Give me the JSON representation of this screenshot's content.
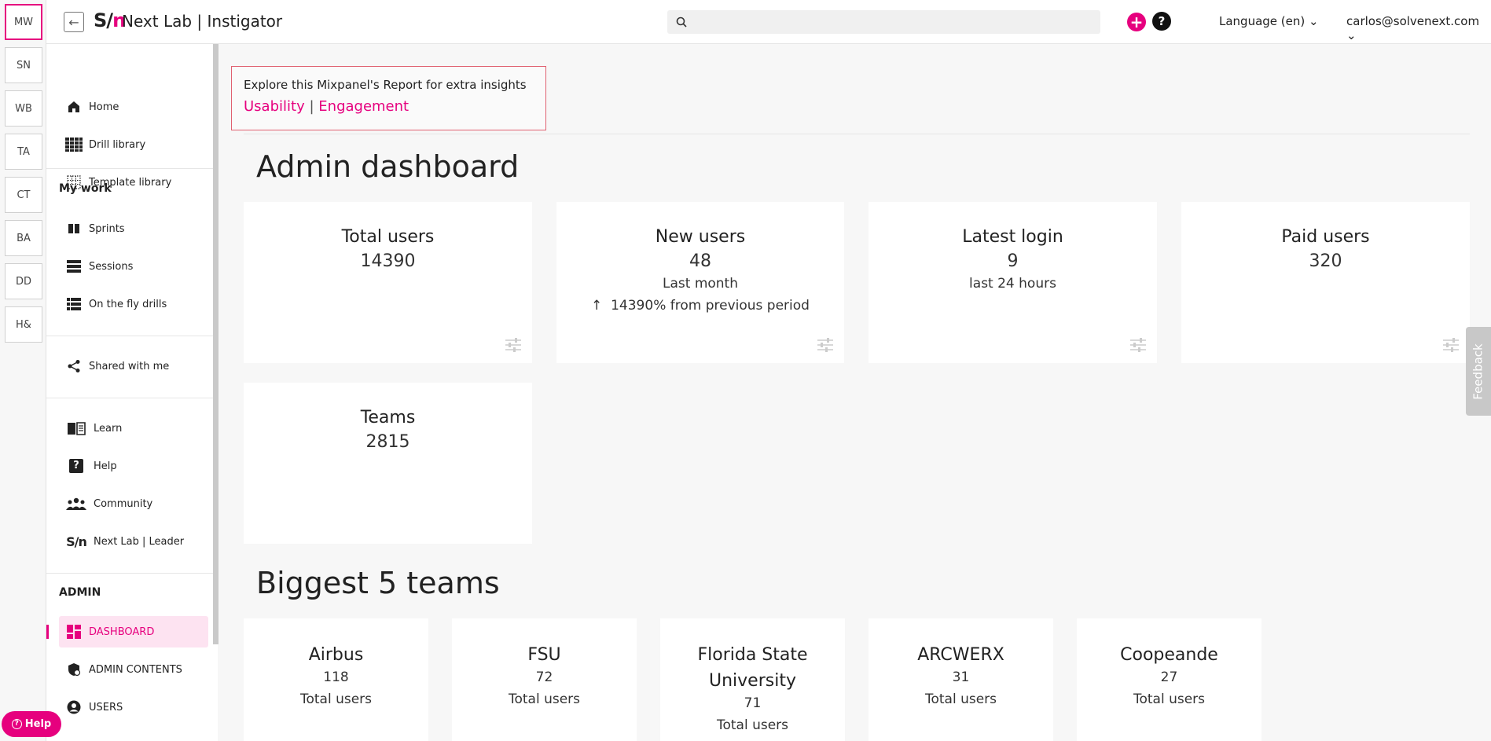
{
  "workspaces": [
    "MW",
    "SN",
    "WB",
    "TA",
    "CT",
    "BA",
    "DD",
    "H&"
  ],
  "header": {
    "logo": "S/n",
    "title": "Next Lab | Instigator",
    "search_placeholder": "",
    "add_label": "+",
    "help_label": "?",
    "language": "Language (en)",
    "user": "carlos@solvenext.com"
  },
  "sidebar": {
    "nav": [
      {
        "label": "Home",
        "icon": "home-icon"
      },
      {
        "label": "Drill library",
        "icon": "grid-icon"
      },
      {
        "label": "Template library",
        "icon": "dotted-grid-icon"
      }
    ],
    "my_work_title": "My work",
    "my_work": [
      {
        "label": "Sprints",
        "icon": "columns-icon"
      },
      {
        "label": "Sessions",
        "icon": "stack-icon"
      },
      {
        "label": "On the fly drills",
        "icon": "list-icon"
      }
    ],
    "shared": {
      "label": "Shared with me",
      "icon": "share-icon"
    },
    "resources": [
      {
        "label": "Learn",
        "icon": "book-icon"
      },
      {
        "label": "Help",
        "icon": "question-icon"
      },
      {
        "label": "Community",
        "icon": "community-icon"
      },
      {
        "label": "Next Lab | Leader",
        "icon": "logo-icon"
      }
    ],
    "admin_title": "ADMIN",
    "admin": [
      {
        "label": "DASHBOARD",
        "icon": "dashboard-icon"
      },
      {
        "label": "ADMIN CONTENTS",
        "icon": "shield-icon"
      },
      {
        "label": "USERS",
        "icon": "user-icon"
      }
    ]
  },
  "insight": {
    "text": "Explore this Mixpanel's Report for extra insights",
    "link1": "Usability",
    "separator": "|",
    "link2": "Engagement"
  },
  "dashboard": {
    "title": "Admin dashboard",
    "cards": [
      {
        "title": "Total users",
        "value": "14390"
      },
      {
        "title": "New users",
        "value": "48",
        "sub": "Last month",
        "trend_arrow": "↑",
        "trend": "14390% from previous period"
      },
      {
        "title": "Latest login",
        "value": "9",
        "sub": "last 24 hours"
      },
      {
        "title": "Paid users",
        "value": "320"
      },
      {
        "title": "Teams",
        "value": "2815"
      }
    ]
  },
  "teams": {
    "title": "Biggest 5 teams",
    "items": [
      {
        "name": "Airbus",
        "count": "118",
        "label": "Total users"
      },
      {
        "name": "FSU",
        "count": "72",
        "label": "Total users"
      },
      {
        "name": "Florida State University",
        "count": "71",
        "label": "Total users"
      },
      {
        "name": "ARCWERX",
        "count": "31",
        "label": "Total users"
      },
      {
        "name": "Coopeande",
        "count": "27",
        "label": "Total users"
      }
    ]
  },
  "feedback": "Feedback",
  "help_bubble": "Help",
  "colors": {
    "accent": "#e6007e",
    "active_bg": "#fde3f1"
  }
}
